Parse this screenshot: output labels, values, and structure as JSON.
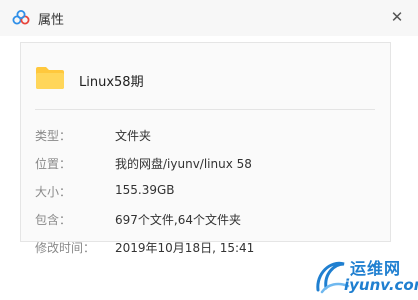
{
  "window": {
    "title": "属性",
    "close_symbol": "✕"
  },
  "item": {
    "icon": "folder-icon",
    "name": "Linux58期"
  },
  "properties": [
    {
      "label": "类型：",
      "value": "文件夹"
    },
    {
      "label": "位置：",
      "value": "我的网盘/iyunv/linux 58"
    },
    {
      "label": "大小：",
      "value": "155.39GB"
    },
    {
      "label": "包含：",
      "value": "697个文件,64个文件夹"
    },
    {
      "label": "修改时间：",
      "value": "2019年10月18日, 15:41"
    }
  ],
  "watermark": {
    "brand": "运维网",
    "domain": "iyunv.com"
  },
  "colors": {
    "folder": "#ffc83d",
    "brand_blue": "#1f7fd0"
  }
}
